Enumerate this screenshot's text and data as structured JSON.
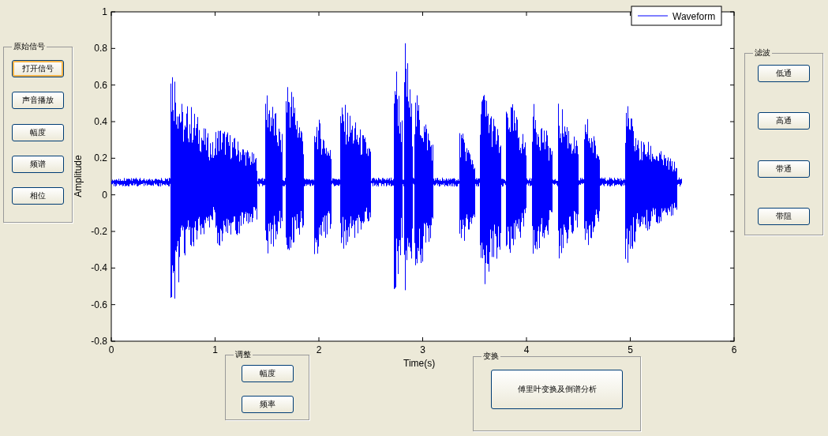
{
  "left_panel": {
    "title": "原始信号",
    "buttons": [
      {
        "label": "打开信号",
        "focused": true
      },
      {
        "label": "声音播放",
        "focused": false
      },
      {
        "label": "幅度",
        "focused": false
      },
      {
        "label": "频谱",
        "focused": false
      },
      {
        "label": "相位",
        "focused": false
      }
    ]
  },
  "plot": {
    "legend": "Waveform",
    "xlabel": "Time(s)",
    "ylabel": "Amplitude",
    "xticks": [
      "0",
      "1",
      "2",
      "3",
      "4",
      "5",
      "6"
    ],
    "yticks": [
      "1",
      "0.8",
      "0.6",
      "0.4",
      "0.2",
      "0",
      "-0.2",
      "-0.4",
      "-0.6",
      "-0.8"
    ]
  },
  "right_panel": {
    "title": "滤波",
    "buttons": [
      {
        "label": "低通",
        "focused": false
      },
      {
        "label": "高通",
        "focused": false
      },
      {
        "label": "带通",
        "focused": false
      },
      {
        "label": "带阻",
        "focused": false
      }
    ]
  },
  "adjust_panel": {
    "title": "调整",
    "buttons": [
      {
        "label": "幅度",
        "focused": false
      },
      {
        "label": "频率",
        "focused": false
      }
    ]
  },
  "transform_panel": {
    "title": "变换",
    "buttons": [
      {
        "label": "傅里叶变换及倒谱分析",
        "focused": false
      }
    ]
  }
}
